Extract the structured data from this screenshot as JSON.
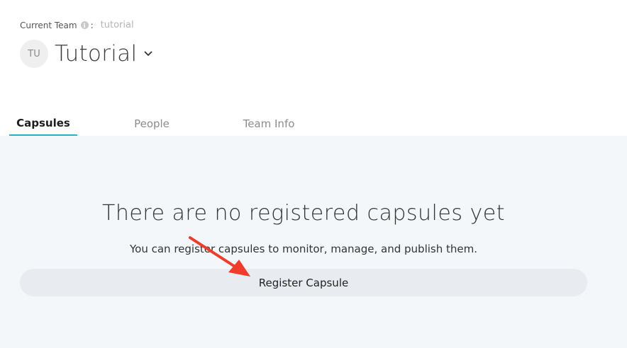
{
  "header": {
    "team_label": "Current Team",
    "colon": ":",
    "team_slug": "tutorial",
    "avatar_initials": "TU",
    "team_name": "Tutorial"
  },
  "tabs": [
    {
      "label": "Capsules",
      "active": true
    },
    {
      "label": "People",
      "active": false
    },
    {
      "label": "Team Info",
      "active": false
    }
  ],
  "empty_state": {
    "title": "There are no registered capsules yet",
    "subtitle": "You can register capsules to monitor, manage, and publish them.",
    "button_label": "Register Capsule"
  },
  "colors": {
    "active_tab_underline": "#26b3c7",
    "panel_background": "#f4f7fa",
    "button_background": "#e8ebef",
    "annotation_arrow": "#f03c2a"
  },
  "icons": {
    "info": "info-icon",
    "chevron": "chevron-down-icon",
    "annotation": "red-arrow-annotation"
  }
}
